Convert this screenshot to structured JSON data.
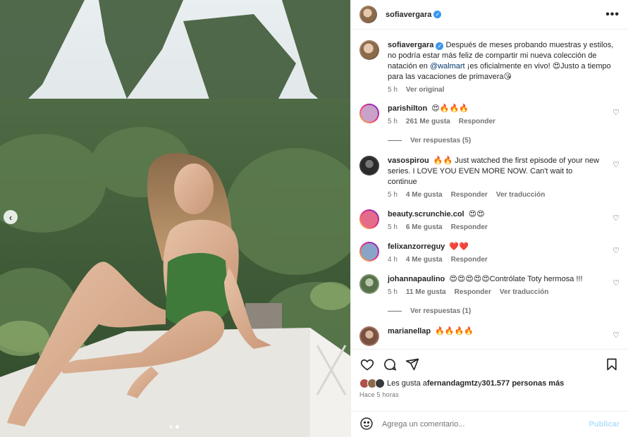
{
  "post": {
    "author": "sofiavergara",
    "more_icon": "more-dots-icon",
    "verified_icon": "verified-badge-icon",
    "photo_dots": 2,
    "photo_active_index": 1,
    "nav_prev_glyph": "‹"
  },
  "caption": {
    "author": "sofiavergara",
    "text_before": "Después de meses probando muestras y estilos, no podría estar más feliz de compartir mi nueva colección de natación en ",
    "mention": "@walmart",
    "text_after": " ¡es oficialmente en vivo! 😍Justo a tiempo para las vacaciones de primavera😘",
    "time": "5 h",
    "see_original": "Ver original"
  },
  "comments": [
    {
      "author": "parishilton",
      "text": "😍🔥🔥🔥",
      "time": "5 h",
      "likes": "261 Me gusta",
      "reply": "Responder",
      "translate": "",
      "avatar_color": "#c8a2c8",
      "replies_label": "Ver respuestas (5)"
    },
    {
      "author": "vasospirou",
      "text": "🔥🔥 Just watched the first episode of your new series. I LOVE YOU EVEN MORE NOW. Can't wait to continue",
      "time": "5 h",
      "likes": "4 Me gusta",
      "reply": "Responder",
      "translate": "Ver traducción",
      "avatar_color": "#3a3a3a",
      "replies_label": ""
    },
    {
      "author": "beauty.scrunchie.col",
      "text": "😍😍",
      "time": "5 h",
      "likes": "6 Me gusta",
      "reply": "Responder",
      "translate": "",
      "avatar_color": "#e46b8a",
      "replies_label": ""
    },
    {
      "author": "felixanzorreguy",
      "text": "❤️❤️",
      "time": "4 h",
      "likes": "4 Me gusta",
      "reply": "Responder",
      "translate": "",
      "avatar_color": "#8aa4c8",
      "replies_label": ""
    },
    {
      "author": "johannapaulino",
      "text": "😍😍😍😍😍Contrólate Toty hermosa !!!",
      "time": "5 h",
      "likes": "11 Me gusta",
      "reply": "Responder",
      "translate": "Ver traducción",
      "avatar_color": "#7a8f6a",
      "replies_label": "Ver respuestas (1)"
    },
    {
      "author": "marianellap",
      "text": "🔥🔥🔥🔥",
      "time": "",
      "likes": "",
      "reply": "",
      "translate": "",
      "avatar_color": "#a07060",
      "replies_label": ""
    }
  ],
  "actions": {
    "like_icon": "heart-icon",
    "comment_icon": "comment-icon",
    "share_icon": "share-icon",
    "save_icon": "bookmark-icon",
    "likes_prefix": "Les gusta a ",
    "likes_user": "fernandagmtz",
    "likes_middle": " y ",
    "likes_count": "301.577 personas más",
    "ago": "Hace 5 horas"
  },
  "composer": {
    "placeholder": "Agrega un comentario...",
    "post_label": "Publicar",
    "emoji_icon": "emoji-icon"
  },
  "colors": {
    "verified": "#3897f0",
    "link": "#00376b",
    "muted": "#737373",
    "post_disabled": "#b2dffc"
  }
}
